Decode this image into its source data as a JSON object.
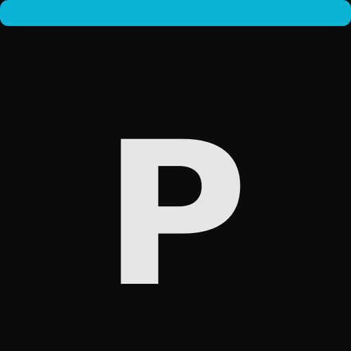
{
  "icon": {
    "letter": "P",
    "letter_color": "#e6e6e6",
    "background_color": "#0b0b0b",
    "accent_color": "#09b3d3"
  }
}
